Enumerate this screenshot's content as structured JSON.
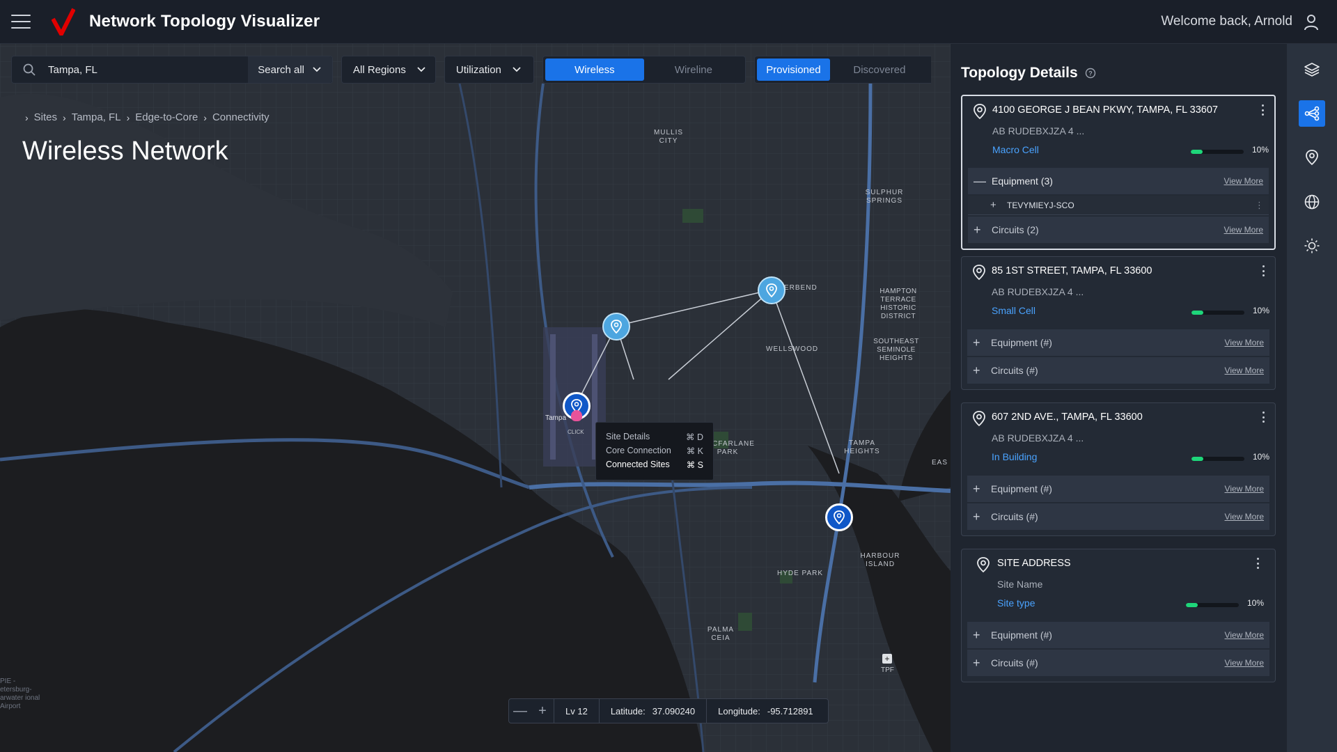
{
  "header": {
    "app_title": "Network Topology Visualizer",
    "welcome": "Welcome back, Arnold",
    "brand_color": "#e00000"
  },
  "toolbar": {
    "search_value": "Tampa, FL",
    "search_scope": "Search all",
    "regions": "All Regions",
    "metric": "Utilization",
    "network_tabs": [
      "Wireless",
      "Wireline"
    ],
    "status_tabs": [
      "Provisioned",
      "Discovered"
    ],
    "active_color": "#1a73e8"
  },
  "breadcrumb": [
    "Sites",
    "Tampa, FL",
    "Edge-to-Core",
    "Connectivity"
  ],
  "page_title": "Wireless Network",
  "map_labels": {
    "mullis": "MULLIS CITY",
    "sulphur": "SULPHUR SPRINGS",
    "hampton": "HAMPTON TERRACE HISTORIC DISTRICT",
    "seminole": "SOUTHEAST SEMINOLE HEIGHTS",
    "riverbend": "ERBEND",
    "wellswood": "WELLSWOOD",
    "macfarlane": "MACFARLANE PARK",
    "tampa_heights": "TAMPA HEIGHTS",
    "hyde_park": "HYDE PARK",
    "harbour": "HARBOUR ISLAND",
    "palma": "PALMA CEIA",
    "tampa_airport": "Tampa",
    "tpf": "TPF",
    "eas": "EAS",
    "click": "CLICK",
    "st_pete": "PIE - etersburg- arwater ional Airport"
  },
  "context_menu": [
    {
      "label": "Site Details",
      "shortcut": "⌘ D"
    },
    {
      "label": "Core Connection",
      "shortcut": "⌘ K"
    },
    {
      "label": "Connected Sites",
      "shortcut": "⌘ S"
    }
  ],
  "statusbar": {
    "zoom_out": "—",
    "zoom_in": "+",
    "level": "Lv 12",
    "latitude_label": "Latitude:",
    "latitude": "37.090240",
    "longitude_label": "Longitude:",
    "longitude": "-95.712891"
  },
  "panel": {
    "title": "Topology Details",
    "view_more": "View More",
    "cards": [
      {
        "address": "4100 GEORGE J BEAN PKWY, TAMPA, FL 33607",
        "site": "AB RUDEBXJZA 4 ...",
        "type": "Macro Cell",
        "utilization": 0.1,
        "pct": "10%",
        "equipment": "Equipment (3)",
        "equipment_item": "TEVYMIEYJ-SCO",
        "circuits": "Circuits (2)"
      },
      {
        "address": "85 1ST STREET, TAMPA, FL 33600",
        "site": "AB RUDEBXJZA 4 ...",
        "type": "Small Cell",
        "utilization": 0.1,
        "pct": "10%",
        "equipment": "Equipment (#)",
        "circuits": "Circuits (#)"
      },
      {
        "address": "607 2ND AVE., TAMPA, FL 33600",
        "site": "AB RUDEBXJZA 4 ...",
        "type": "In Building",
        "utilization": 0.1,
        "pct": "10%",
        "equipment": "Equipment (#)",
        "circuits": "Circuits (#)"
      },
      {
        "address": "SITE ADDRESS",
        "site": "Site Name",
        "type": "Site type",
        "utilization": 0.1,
        "pct": "10%",
        "equipment": "Equipment (#)",
        "circuits": "Circuits (#)"
      }
    ]
  },
  "rail": [
    "layers-icon",
    "topology-icon",
    "location-pin-icon",
    "globe-icon",
    "brightness-icon"
  ]
}
